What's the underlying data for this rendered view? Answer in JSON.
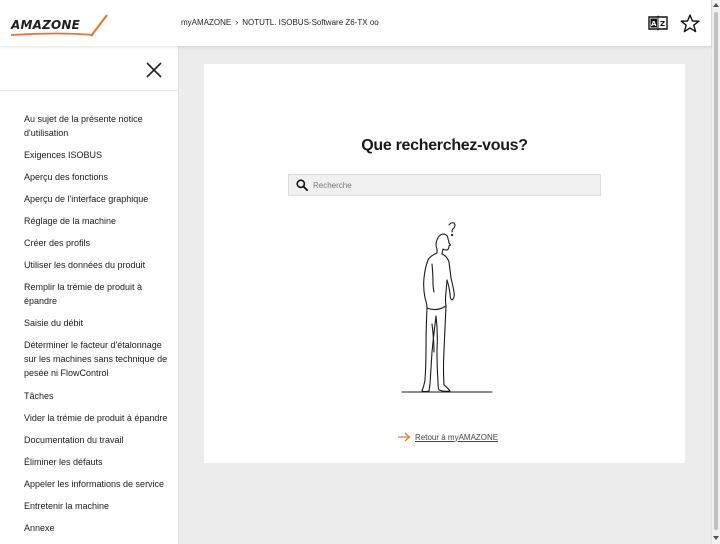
{
  "brand": {
    "logo_text": "AMAZONE",
    "accent_color": "#e4752b"
  },
  "breadcrumb": {
    "items": [
      "myAMAZONE",
      "NOTUTL. ISOBUS-Software Z6-TX oo"
    ],
    "separator": "›"
  },
  "header": {
    "icons": [
      "dictionary-icon",
      "favorite-star-icon"
    ]
  },
  "sidebar": {
    "close_icon": "close-icon",
    "items": [
      {
        "label": "Au sujet de la présente notice d'utilisation"
      },
      {
        "label": "Exigences ISOBUS"
      },
      {
        "label": "Aperçu des fonctions"
      },
      {
        "label": "Aperçu de l'interface graphique"
      },
      {
        "label": "Réglage de la machine"
      },
      {
        "label": "Créer des profils"
      },
      {
        "label": "Utiliser les données du produit"
      },
      {
        "label": "Remplir la trémie de produit à épandre"
      },
      {
        "label": "Saisie du débit"
      },
      {
        "label": "Déterminer le facteur d'étalonnage sur les machines sans technique de pesée ni FlowControl"
      },
      {
        "label": "Tâches"
      },
      {
        "label": "Vider la trémie de produit à épandre"
      },
      {
        "label": "Documentation du travail"
      },
      {
        "label": "Éliminer les défauts"
      },
      {
        "label": "Appeler les informations de service"
      },
      {
        "label": "Entretenir la machine"
      },
      {
        "label": "Annexe"
      }
    ]
  },
  "main": {
    "title": "Que recherchez-vous?",
    "search": {
      "placeholder": "Recherche",
      "value": ""
    },
    "back_link": "Retour à myAMAZONE"
  }
}
